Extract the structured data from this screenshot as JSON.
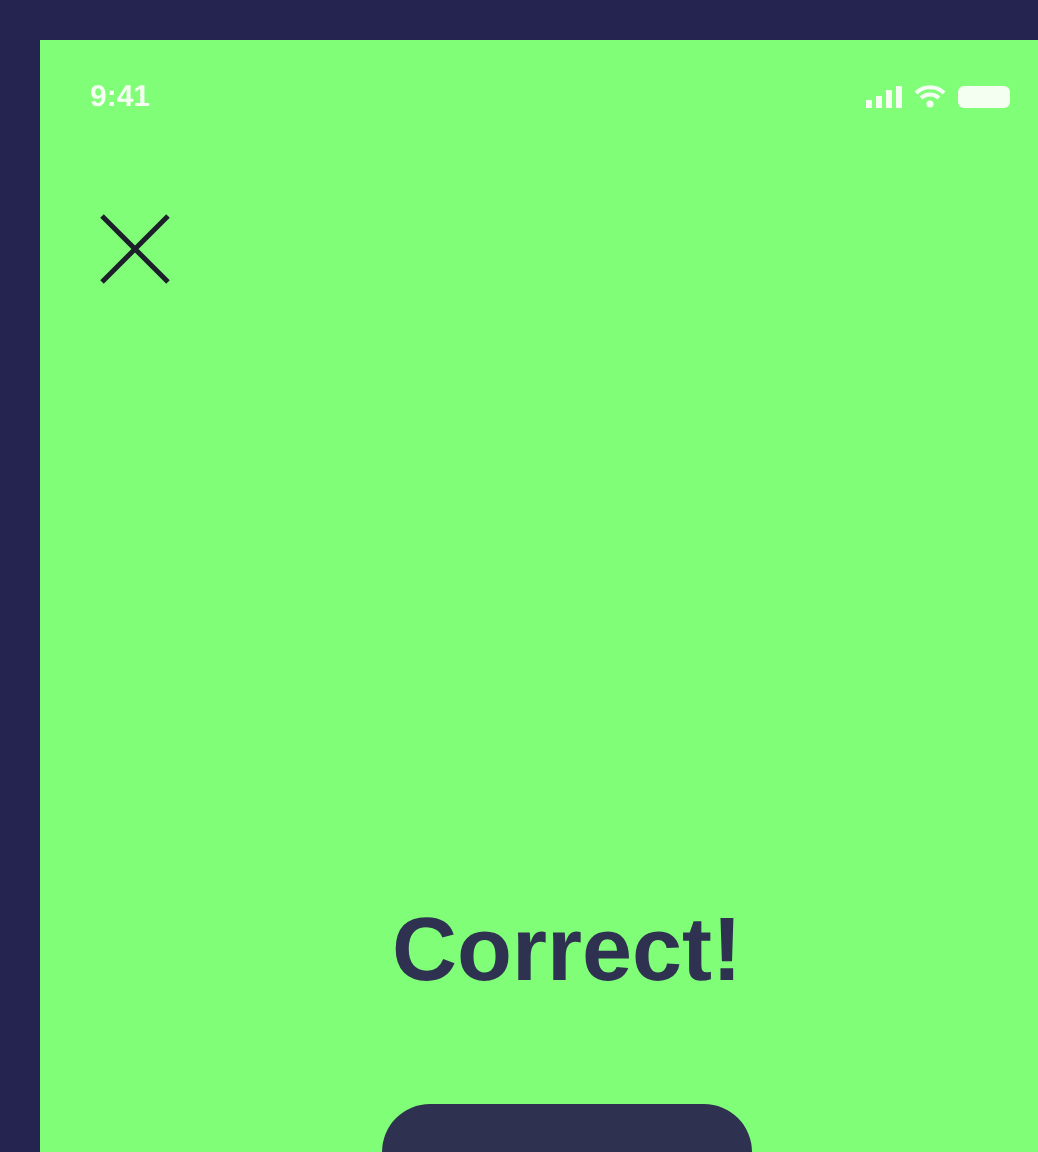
{
  "status_bar": {
    "time": "9:41"
  },
  "result": {
    "title": "Correct!"
  }
}
